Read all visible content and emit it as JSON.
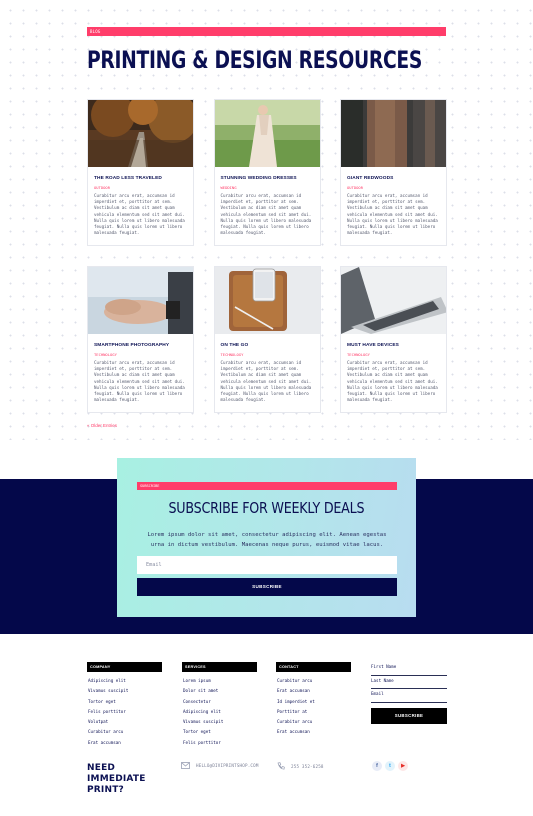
{
  "header": {
    "tag": "BLOG",
    "title": "PRINTING & DESIGN RESOURCES"
  },
  "posts": [
    {
      "title": "THE ROAD LESS TRAVELED",
      "category": "OUTDOOR",
      "excerpt": "Curabitur arcu erat, accumsan id imperdiet et, porttitor at sem. Vestibulum ac diam sit amet quam vehicula elementum sed sit amet dui. Nulla quis lorem ut libero malesuada feugiat. Nulla quis lorem ut libero malesuada feugiat."
    },
    {
      "title": "STUNNING WEDDING DRESSES",
      "category": "WEDDING",
      "excerpt": "Curabitur arcu erat, accumsan id imperdiet et, porttitor at sem. Vestibulum ac diam sit amet quam vehicula elementum sed sit amet dui. Nulla quis lorem ut libero malesuada feugiat. Nulla quis lorem ut libero malesuada feugiat."
    },
    {
      "title": "GIANT REDWOODS",
      "category": "OUTDOOR",
      "excerpt": "Curabitur arcu erat, accumsan id imperdiet et, porttitor at sem. Vestibulum ac diam sit amet quam vehicula elementum sed sit amet dui. Nulla quis lorem ut libero malesuada feugiat. Nulla quis lorem ut libero malesuada feugiat."
    },
    {
      "title": "SMARTPHONE PHOTOGRAPHY",
      "category": "TECHNOLOGY",
      "excerpt": "Curabitur arcu erat, accumsan id imperdiet et, porttitor at sem. Vestibulum ac diam sit amet quam vehicula elementum sed sit amet dui. Nulla quis lorem ut libero malesuada feugiat. Nulla quis lorem ut libero malesuada feugiat."
    },
    {
      "title": "ON THE GO",
      "category": "TECHNOLOGY",
      "excerpt": "Curabitur arcu erat, accumsan id imperdiet et, porttitor at sem. Vestibulum ac diam sit amet quam vehicula elementum sed sit amet dui. Nulla quis lorem ut libero malesuada feugiat. Nulla quis lorem ut libero malesuada feugiat."
    },
    {
      "title": "MUST HAVE DEVICES",
      "category": "TECHNOLOGY",
      "excerpt": "Curabitur arcu erat, accumsan id imperdiet et, porttitor at sem. Vestibulum ac diam sit amet quam vehicula elementum sed sit amet dui. Nulla quis lorem ut libero malesuada feugiat. Nulla quis lorem ut libero malesuada feugiat."
    }
  ],
  "pagination": {
    "older": "« Older Entries"
  },
  "subscribe": {
    "tag": "SUBSCRIBE",
    "title": "SUBSCRIBE FOR WEEKLY DEALS",
    "text": "Lorem ipsum dolor sit amet, consectetur adipiscing elit. Aenean egestas urna in dictum vestibulum. Maecenas neque purus, euismod vitae lacus.",
    "email_placeholder": "Email",
    "button": "SUBSCRIBE"
  },
  "footer": {
    "company": {
      "heading": "COMPANY",
      "links": [
        "Adipiscing elit",
        "Vivamus suscipit",
        "Tortor eget",
        "Felis porttitor",
        "Volutpat",
        "Curabitur arcu",
        "Erat accumsan"
      ]
    },
    "services": {
      "heading": "SERVICES",
      "links": [
        "Lorem ipsum",
        "Dolor sit amet",
        "Consectetur",
        "Adipiscing elit",
        "Vivamus suscipit",
        "Tortor eget",
        "Felis porttitor"
      ]
    },
    "contact": {
      "heading": "CONTACT",
      "links": [
        "Curabitur arcu",
        "Erat accumsan",
        "Id imperdiet et",
        "Porttitor at",
        "Curabitur arcu",
        "Erat accumsan"
      ]
    },
    "form": {
      "first_name": "First Name",
      "last_name": "Last Name",
      "email": "Email",
      "button": "SUBSCRIBE"
    },
    "cta": "NEED IMMEDIATE PRINT?",
    "email": "HELLO@DIVIPRINTSHOP.COM",
    "phone": "255 352-6258",
    "social_icons": [
      "facebook-icon",
      "twitter-icon",
      "youtube-icon"
    ]
  }
}
